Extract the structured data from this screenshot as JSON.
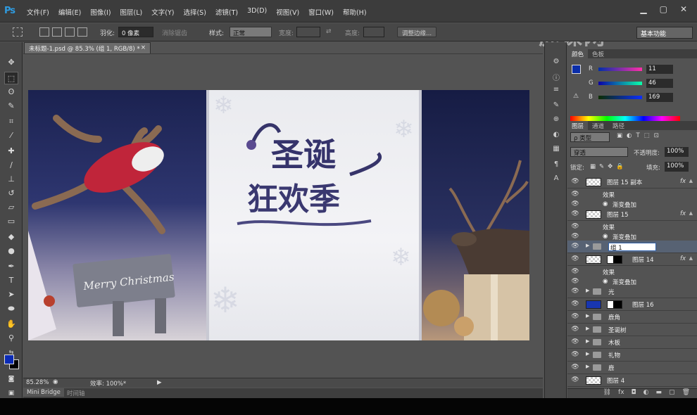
{
  "app": {
    "logo": "Ps"
  },
  "menu": [
    "文件(F)",
    "编辑(E)",
    "图像(I)",
    "图层(L)",
    "文字(Y)",
    "选择(S)",
    "滤镜(T)",
    "3D(D)",
    "视图(V)",
    "窗口(W)",
    "帮助(H)"
  ],
  "watermark": "虎课网",
  "options": {
    "feather_label": "羽化:",
    "feather_value": "0 像素",
    "antialias": "消除锯齿",
    "style_label": "样式:",
    "style_value": "正常",
    "width_label": "宽度:",
    "height_label": "高度:",
    "refine_button": "调整边缘...",
    "workspace": "基本功能"
  },
  "document": {
    "tab_title": "未标题-1.psd @ 85.3% (组 1, RGB/8) *",
    "zoom": "85.28%",
    "efficiency": "效率: 100%*"
  },
  "canvas": {
    "left_sign": "Merry Christmas",
    "title_line1": "圣诞",
    "title_line2": "狂欢季"
  },
  "bottom_tabs": [
    "Mini Bridge",
    "时间轴"
  ],
  "color_panel": {
    "tabs": [
      "颜色",
      "色板"
    ],
    "r_label": "R",
    "g_label": "G",
    "b_label": "B",
    "r": "11",
    "g": "46",
    "b": "169",
    "fg_color": "#0b2ea9"
  },
  "layers_panel": {
    "tabs": [
      "图层",
      "通道",
      "路径"
    ],
    "kind_filter": "ρ 类型",
    "blend_mode": "穿透",
    "opacity_label": "不透明度:",
    "opacity": "100%",
    "lock_label": "锁定:",
    "fill_label": "填充:",
    "fill": "100%",
    "layers": [
      {
        "name": "图层 15 副本",
        "kind": "pixel",
        "fx": "fx"
      },
      {
        "name": "效果",
        "kind": "effects"
      },
      {
        "name": "渐变叠加",
        "kind": "effect"
      },
      {
        "name": "图层 15",
        "kind": "pixel",
        "fx": "fx"
      },
      {
        "name": "效果",
        "kind": "effects"
      },
      {
        "name": "渐变叠加",
        "kind": "effect"
      },
      {
        "name": "组 1",
        "kind": "group",
        "selected": true
      },
      {
        "name": "图层 14",
        "kind": "masked",
        "fx": "fx"
      },
      {
        "name": "效果",
        "kind": "effects"
      },
      {
        "name": "渐变叠加",
        "kind": "effect"
      },
      {
        "name": "光",
        "kind": "group"
      },
      {
        "name": "图层 16",
        "kind": "blue-masked"
      },
      {
        "name": "鹿角",
        "kind": "group"
      },
      {
        "name": "圣诞树",
        "kind": "group"
      },
      {
        "name": "木板",
        "kind": "group"
      },
      {
        "name": "礼物",
        "kind": "group"
      },
      {
        "name": "鹿",
        "kind": "group"
      },
      {
        "name": "图层 4",
        "kind": "pixel"
      }
    ]
  },
  "tools": [
    "move-tool",
    "marquee-tool",
    "lasso-tool",
    "quick-select-tool",
    "crop-tool",
    "eyedropper-tool",
    "healing-tool",
    "brush-tool",
    "stamp-tool",
    "history-brush-tool",
    "eraser-tool",
    "gradient-tool",
    "blur-tool",
    "dodge-tool",
    "pen-tool",
    "type-tool",
    "path-select-tool",
    "shape-tool",
    "hand-tool",
    "zoom-tool"
  ]
}
